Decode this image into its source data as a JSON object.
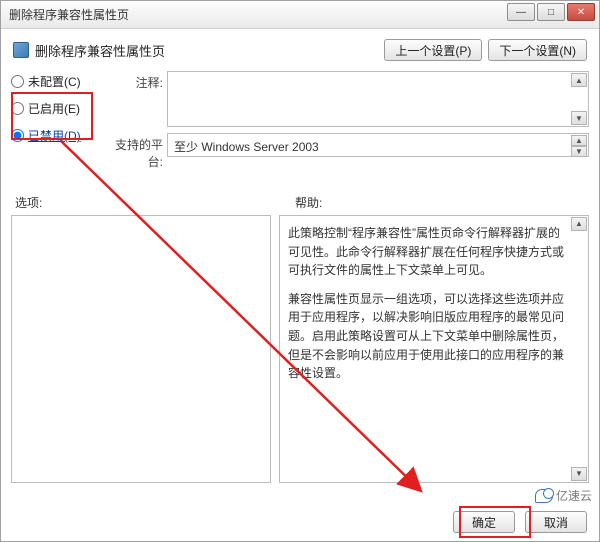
{
  "window": {
    "title": "删除程序兼容性属性页"
  },
  "header": {
    "title": "删除程序兼容性属性页"
  },
  "nav": {
    "prev": "上一个设置(P)",
    "next": "下一个设置(N)"
  },
  "radios": {
    "not_configured": "未配置(C)",
    "enabled": "已启用(E)",
    "disabled": "已禁用(D)",
    "selected": "disabled"
  },
  "labels": {
    "note": "注释:",
    "platform": "支持的平台:",
    "options": "选项:",
    "help": "帮助:"
  },
  "platform_text": "至少 Windows Server 2003",
  "help_paragraphs": [
    "此策略控制“程序兼容性”属性页命令行解释器扩展的可见性。此命令行解释器扩展在任何程序快捷方式或可执行文件的属性上下文菜单上可见。",
    "兼容性属性页显示一组选项，可以选择这些选项并应用于应用程序，以解决影响旧版应用程序的最常见问题。启用此策略设置可从上下文菜单中删除属性页，但是不会影响以前应用于使用此接口的应用程序的兼容性设置。"
  ],
  "footer": {
    "ok": "确定",
    "cancel": "取消"
  },
  "watermark": "亿速云"
}
